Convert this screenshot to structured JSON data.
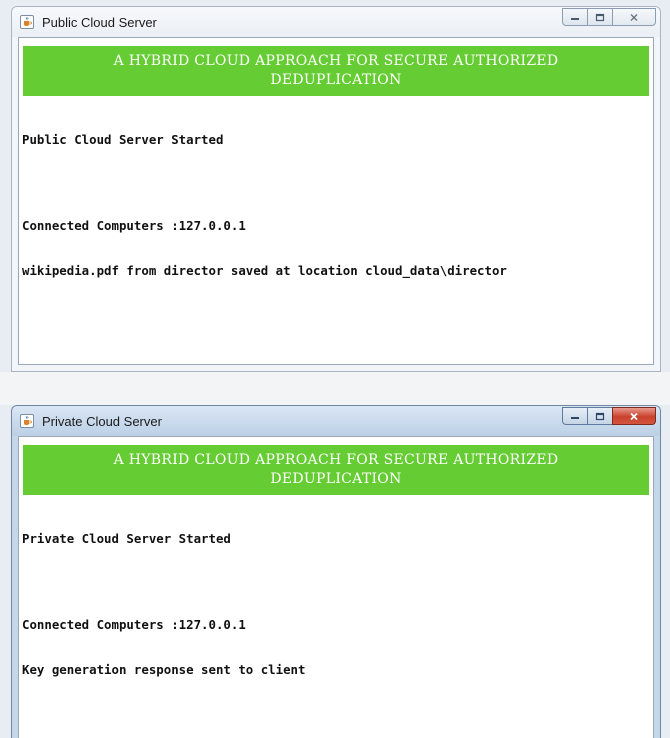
{
  "public_window": {
    "title": "Public Cloud Server",
    "banner": "A HYBRID CLOUD APPROACH FOR SECURE AUTHORIZED DEDUPLICATION",
    "log": [
      "Public Cloud Server Started",
      "Connected Computers :127.0.0.1",
      "wikipedia.pdf from director saved at location cloud_data\\director"
    ]
  },
  "private_window": {
    "title": "Private Cloud Server",
    "banner": "A HYBRID CLOUD APPROACH FOR SECURE AUTHORIZED DEDUPLICATION",
    "log": [
      "Private Cloud Server Started",
      "Connected Computers :127.0.0.1",
      "Key generation response sent to client"
    ]
  },
  "colors": {
    "banner_green": "#66cc33",
    "close_red": "#c9412c"
  },
  "icons": {
    "app": "java-cup-icon",
    "minimize": "minimize-icon",
    "maximize": "maximize-icon",
    "close": "close-icon"
  }
}
